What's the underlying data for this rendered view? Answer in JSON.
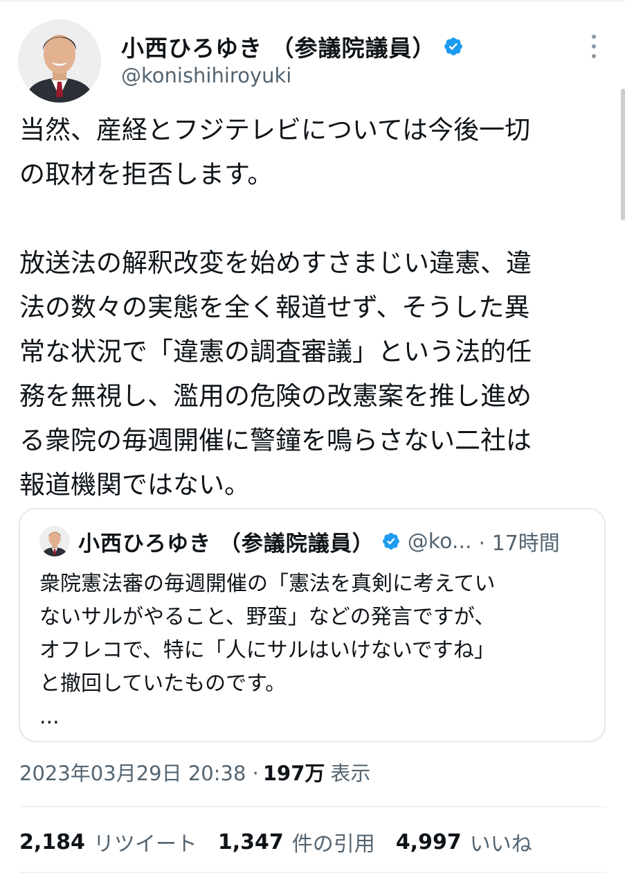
{
  "author": {
    "display_name": "小西ひろゆき （参議院議員）",
    "handle": "@konishihiroyuki",
    "verified_icon": "verified-badge-icon",
    "verified_color": "#1d9bf0"
  },
  "tweet": {
    "lines": [
      "当然、産経とフジテレビについては今後一切",
      "の取材を拒否します。",
      "",
      "放送法の解釈改変を始めすさまじい違憲、違",
      "法の数々の実態を全く報道せず、そうした異",
      "常な状況で「違憲の調査審議」という法的任",
      "務を無視し、濫用の危険の改憲案を推し進め",
      "る衆院の毎週開催に警鐘を鳴らさない二社は",
      "報道機関ではない。"
    ]
  },
  "quoted_tweet": {
    "display_name": "小西ひろゆき （参議院議員）",
    "handle_truncated": "@ko...",
    "time": "· 17時間",
    "lines": [
      "衆院憲法審の毎週開催の「憲法を真剣に考えてい",
      "ないサルがやること、野蛮」などの発言ですが、",
      "オフレコで、特に「人にサルはいけないですね」",
      "と撤回していたものです。",
      "..."
    ]
  },
  "meta": {
    "timestamp": "2023年03月29日 20:38 ·",
    "views_count": "197万",
    "views_label": "表示"
  },
  "stats": {
    "retweets_count": "2,184",
    "retweets_label": "リツイート",
    "quotes_count": "1,347",
    "quotes_label": "件の引用",
    "likes_count": "4,997",
    "likes_label": "いいね"
  },
  "colors": {
    "text_primary": "#0f1419",
    "text_secondary": "#536471",
    "border": "#eff3f4",
    "accent": "#1d9bf0"
  }
}
